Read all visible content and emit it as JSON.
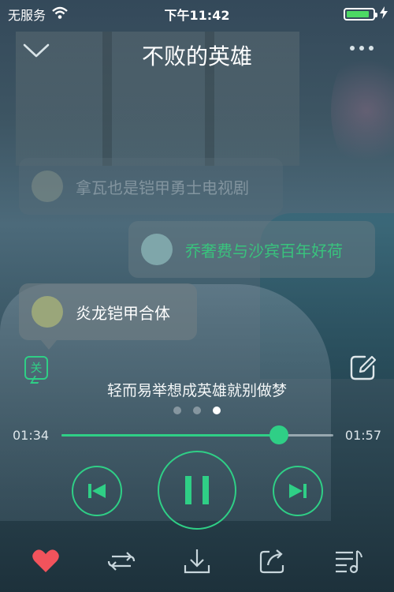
{
  "status_bar": {
    "carrier": "无服务",
    "time": "下午11:42",
    "battery_level": 0.88
  },
  "header": {
    "title": "不败的英雄",
    "back_icon": "chevron-down-icon",
    "more_icon": "more-dots-icon"
  },
  "comments": [
    {
      "text": "拿瓦也是铠甲勇士电视剧"
    },
    {
      "text": "乔奢费与沙宾百年好荷"
    },
    {
      "text": "炎龙铠甲合体"
    }
  ],
  "follow_badge": "关",
  "lyric": "轻而易举想成英雄就别做梦",
  "pager": {
    "count": 3,
    "active": 2
  },
  "player": {
    "current_time": "01:34",
    "total_time": "01:57",
    "progress": 0.8,
    "accent_color": "#2fcf86"
  },
  "toolbar": [
    "heart-icon",
    "repeat-icon",
    "download-icon",
    "share-icon",
    "playlist-icon"
  ]
}
